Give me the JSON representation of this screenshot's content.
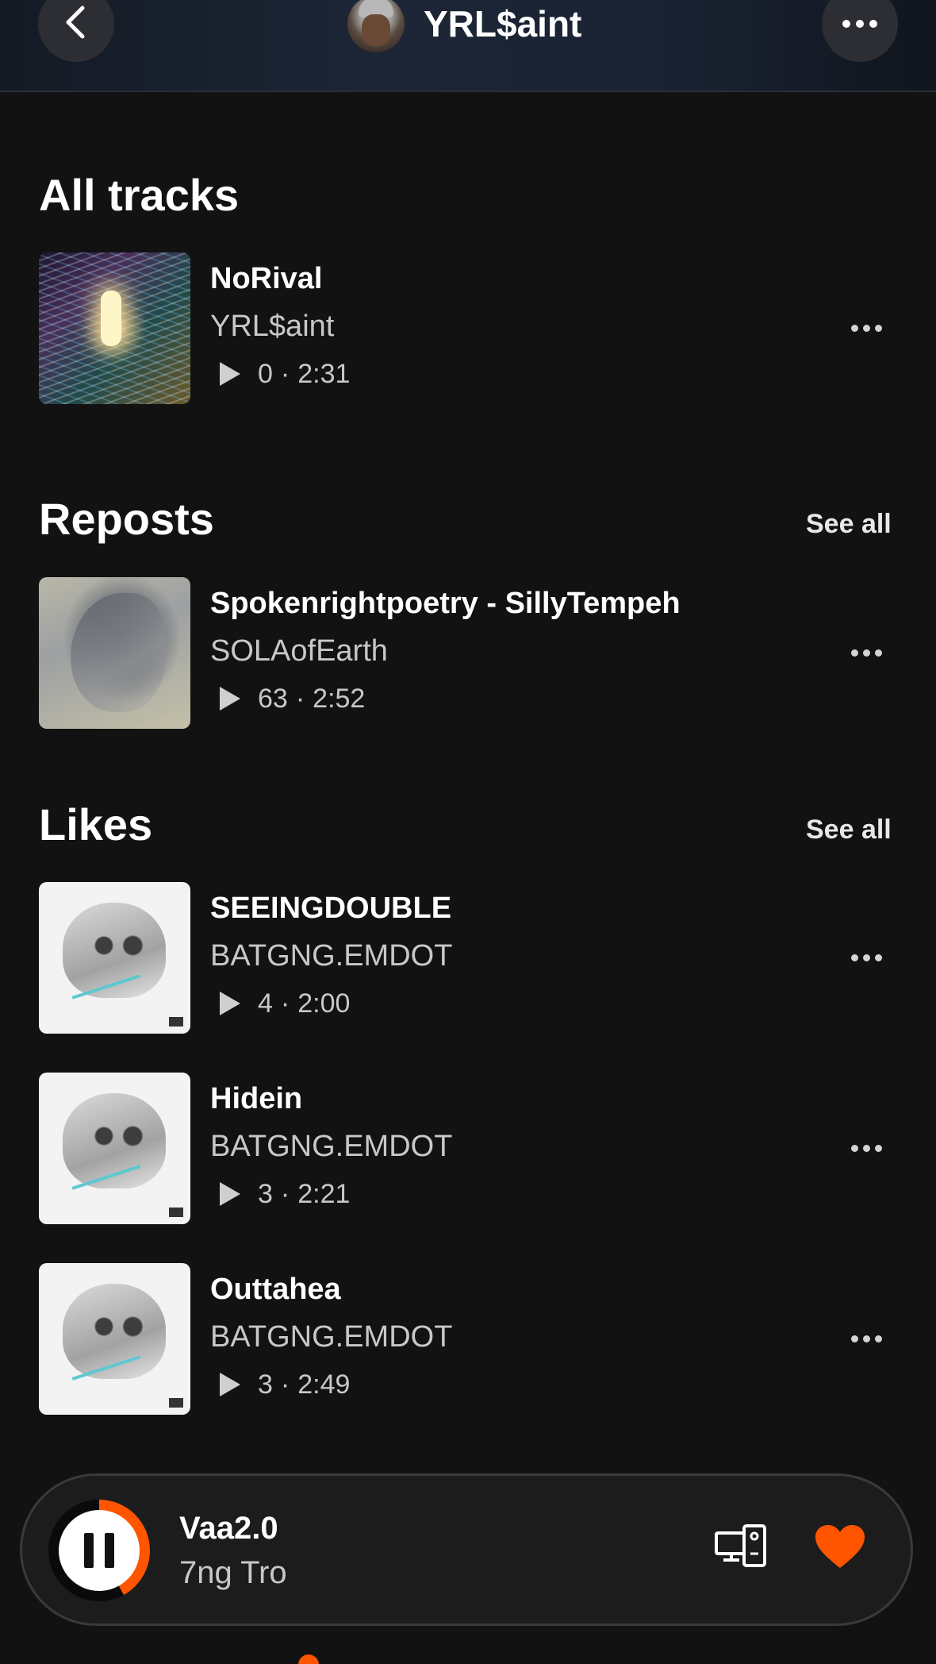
{
  "header": {
    "title": "YRL$aint"
  },
  "sections": {
    "all_tracks": {
      "title": "All tracks",
      "tracks": [
        {
          "title": "NoRival",
          "artist": "YRL$aint",
          "plays": "0",
          "duration": "2:31"
        }
      ]
    },
    "reposts": {
      "title": "Reposts",
      "see_all": "See all",
      "tracks": [
        {
          "title": "Spokenrightpoetry - SillyTempeh",
          "artist": "SOLAofEarth",
          "plays": "63",
          "duration": "2:52"
        }
      ]
    },
    "likes": {
      "title": "Likes",
      "see_all": "See all",
      "tracks": [
        {
          "title": "SEEINGDOUBLE",
          "artist": "BATGNG.EMDOT",
          "plays": "4",
          "duration": "2:00"
        },
        {
          "title": "Hidein",
          "artist": "BATGNG.EMDOT",
          "plays": "3",
          "duration": "2:21"
        },
        {
          "title": "Outtahea",
          "artist": "BATGNG.EMDOT",
          "plays": "3",
          "duration": "2:49"
        }
      ]
    }
  },
  "separator": "·",
  "mini_player": {
    "title": "Vaa2.0",
    "artist": "7ng Tro",
    "progress": 0.42
  },
  "colors": {
    "accent": "#ff5500",
    "background": "#121212"
  },
  "icons": {
    "back": "chevron-left-icon",
    "more": "more-horizontal-icon",
    "play": "play-icon",
    "pause": "pause-icon",
    "devices": "devices-icon",
    "like": "heart-icon"
  }
}
